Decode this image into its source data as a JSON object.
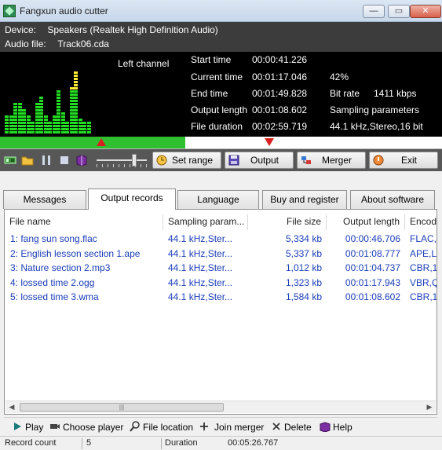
{
  "window": {
    "title": "Fangxun audio cutter",
    "min_glyph": "—",
    "max_glyph": "▭",
    "close_glyph": "✕"
  },
  "info": {
    "device_label": "Device:",
    "device_value": "Speakers (Realtek High Definition Audio)",
    "file_label": "Audio file:",
    "file_value": "Track06.cda"
  },
  "meter": {
    "channel_label": "Left channel",
    "levels": [
      0.3,
      0.3,
      0.5,
      0.5,
      0.4,
      0.3,
      0.2,
      0.5,
      0.6,
      0.3,
      0.2,
      0.3,
      0.7,
      0.35,
      0.2,
      0.75,
      1.0,
      0.25,
      0.2,
      0.2
    ],
    "color_low": "#22dd22",
    "color_high": "#ffee33"
  },
  "stats": {
    "start_label": "Start time",
    "start_value": "00:00:41.226",
    "current_label": "Current time",
    "current_value": "00:01:17.046",
    "end_label": "End time",
    "end_value": "00:01:49.828",
    "output_length_label": "Output length",
    "output_length_value": "00:01:08.602",
    "duration_label": "File duration",
    "duration_value": "00:02:59.719",
    "percent": "42%",
    "bitrate_label": "Bit rate",
    "bitrate_value": "1411 kbps",
    "sampling_label": "Sampling parameters",
    "sampling_value": "44.1  kHz,Stereo,16 bit"
  },
  "progress": {
    "fraction": 0.42,
    "color": "#2fbf2f"
  },
  "volume": {
    "level": 0.78
  },
  "toolbar": {
    "set_range": "Set range",
    "output": "Output",
    "merger": "Merger",
    "exit": "Exit"
  },
  "tabs": [
    "Messages",
    "Output records",
    "Language",
    "Buy and register",
    "About software"
  ],
  "active_tab": 1,
  "table": {
    "columns": [
      "File name",
      "Sampling param...",
      "File size",
      "Output length",
      "Encod"
    ],
    "rows": [
      [
        "1: fang sun song.flac",
        "44.1   kHz,Ster...",
        "5,334 kb",
        "00:00:46.706",
        "FLAC,1"
      ],
      [
        "2: English lesson section 1.ape",
        "44.1   kHz,Ster...",
        "5,337 kb",
        "00:01:08.777",
        "APE,Le"
      ],
      [
        "3: Nature section 2.mp3",
        "44.1   kHz,Ster...",
        "1,012 kb",
        "00:01:04.737",
        "CBR,1"
      ],
      [
        "4: lossed time 2.ogg",
        "44.1   kHz,Ster...",
        "1,323 kb",
        "00:01:17.943",
        "VBR,Q"
      ],
      [
        "5: lossed time 3.wma",
        "44.1   kHz,Ster...",
        "1,584 kb",
        "00:01:08.602",
        "CBR,1"
      ]
    ],
    "row_color": "#1a3db8"
  },
  "actions": {
    "play": "Play",
    "choose_player": "Choose player",
    "file_location": "File location",
    "join_merger": "Join merger",
    "delete": "Delete",
    "help": "Help"
  },
  "status": {
    "record_count_label": "Record count",
    "record_count_value": "5",
    "duration_label": "Duration",
    "duration_value": "00:05:26.767"
  }
}
